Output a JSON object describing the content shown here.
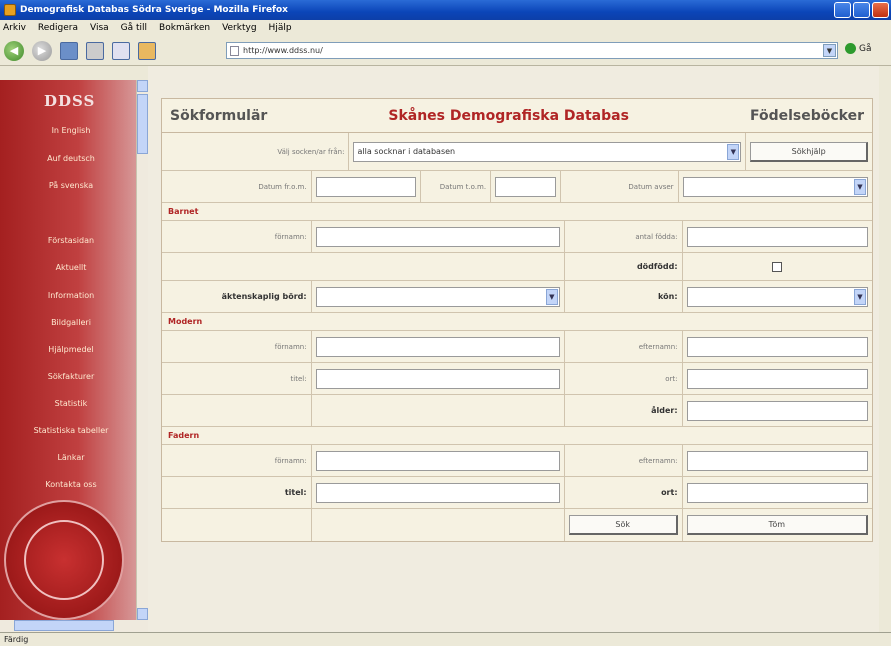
{
  "window": {
    "title": "Demografisk Databas Södra Sverige - Mozilla Firefox"
  },
  "menu": [
    "Arkiv",
    "Redigera",
    "Visa",
    "Gå till",
    "Bokmärken",
    "Verktyg",
    "Hjälp"
  ],
  "address": {
    "url": "http://www.ddss.nu/",
    "go_label": "Gå"
  },
  "sidebar": {
    "logo": "DDSS",
    "links": [
      "In English",
      "Auf deutsch",
      "På svenska",
      "Förstasidan",
      "Aktuellt",
      "Information",
      "Bildgalleri",
      "Hjälpmedel",
      "Sökfakturer",
      "Statistik",
      "Statistiska tabeller",
      "Länkar",
      "Kontakta oss"
    ]
  },
  "form": {
    "title_left": "Sökformulär",
    "title_center": "Skånes Demografiska Databas",
    "title_right": "Födelseböcker",
    "search_from_label": "Välj socken/ar från:",
    "search_from_value": "alla socknar i databasen",
    "search_button": "Sökhjälp",
    "date_from_label": "Datum fr.o.m.",
    "date_to_label": "Datum t.o.m.",
    "date_year_label": "Datum avser",
    "section_child": "Barnet",
    "child_first_label": "förnamn:",
    "child_birthorder_label": "antal födda:",
    "child_stillborn_label": "dödfödd:",
    "child_legit_label": "äktenskaplig börd:",
    "child_sex_label": "kön:",
    "section_mother": "Modern",
    "mother_first_label": "förnamn:",
    "mother_last_label": "efternamn:",
    "mother_title_label": "titel:",
    "mother_place_label": "ort:",
    "mother_age_label": "ålder:",
    "section_father": "Fadern",
    "father_first_label": "förnamn:",
    "father_last_label": "efternamn:",
    "father_title_label": "titel:",
    "father_place_label": "ort:",
    "submit_button": "Sök",
    "clear_button": "Töm"
  },
  "status": "Färdig"
}
